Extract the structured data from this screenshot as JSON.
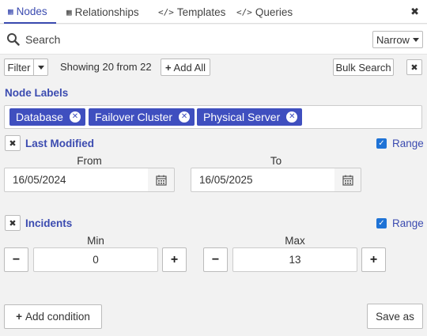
{
  "tabs": [
    {
      "label": "Nodes",
      "icon": "table-icon",
      "active": true
    },
    {
      "label": "Relationships",
      "icon": "table-icon",
      "active": false
    },
    {
      "label": "Templates",
      "icon": "code-icon",
      "active": false
    },
    {
      "label": "Queries",
      "icon": "code-icon",
      "active": false
    }
  ],
  "tab_icons": {
    "table": "▦",
    "code": "</>"
  },
  "search": {
    "placeholder": "Search",
    "mode": "Narrow"
  },
  "toolbar": {
    "filter_label": "Filter",
    "status": "Showing 20 from 22",
    "add_all_label": "Add All",
    "bulk_search_label": "Bulk Search"
  },
  "node_labels": {
    "title": "Node Labels",
    "chips": [
      "Database",
      "Failover Cluster",
      "Physical Server"
    ]
  },
  "last_modified": {
    "title": "Last Modified",
    "range_label": "Range",
    "range_checked": true,
    "from_label": "From",
    "to_label": "To",
    "from_value": "16/05/2024",
    "to_value": "16/05/2025"
  },
  "incidents": {
    "title": "Incidents",
    "range_label": "Range",
    "range_checked": true,
    "min_label": "Min",
    "max_label": "Max",
    "min_value": "0",
    "max_value": "13"
  },
  "footer": {
    "add_condition_label": "Add condition",
    "save_as_label": "Save as"
  },
  "colors": {
    "accent": "#3b4bb0",
    "chip": "#3f4fbf",
    "checkbox": "#1f73d6"
  }
}
